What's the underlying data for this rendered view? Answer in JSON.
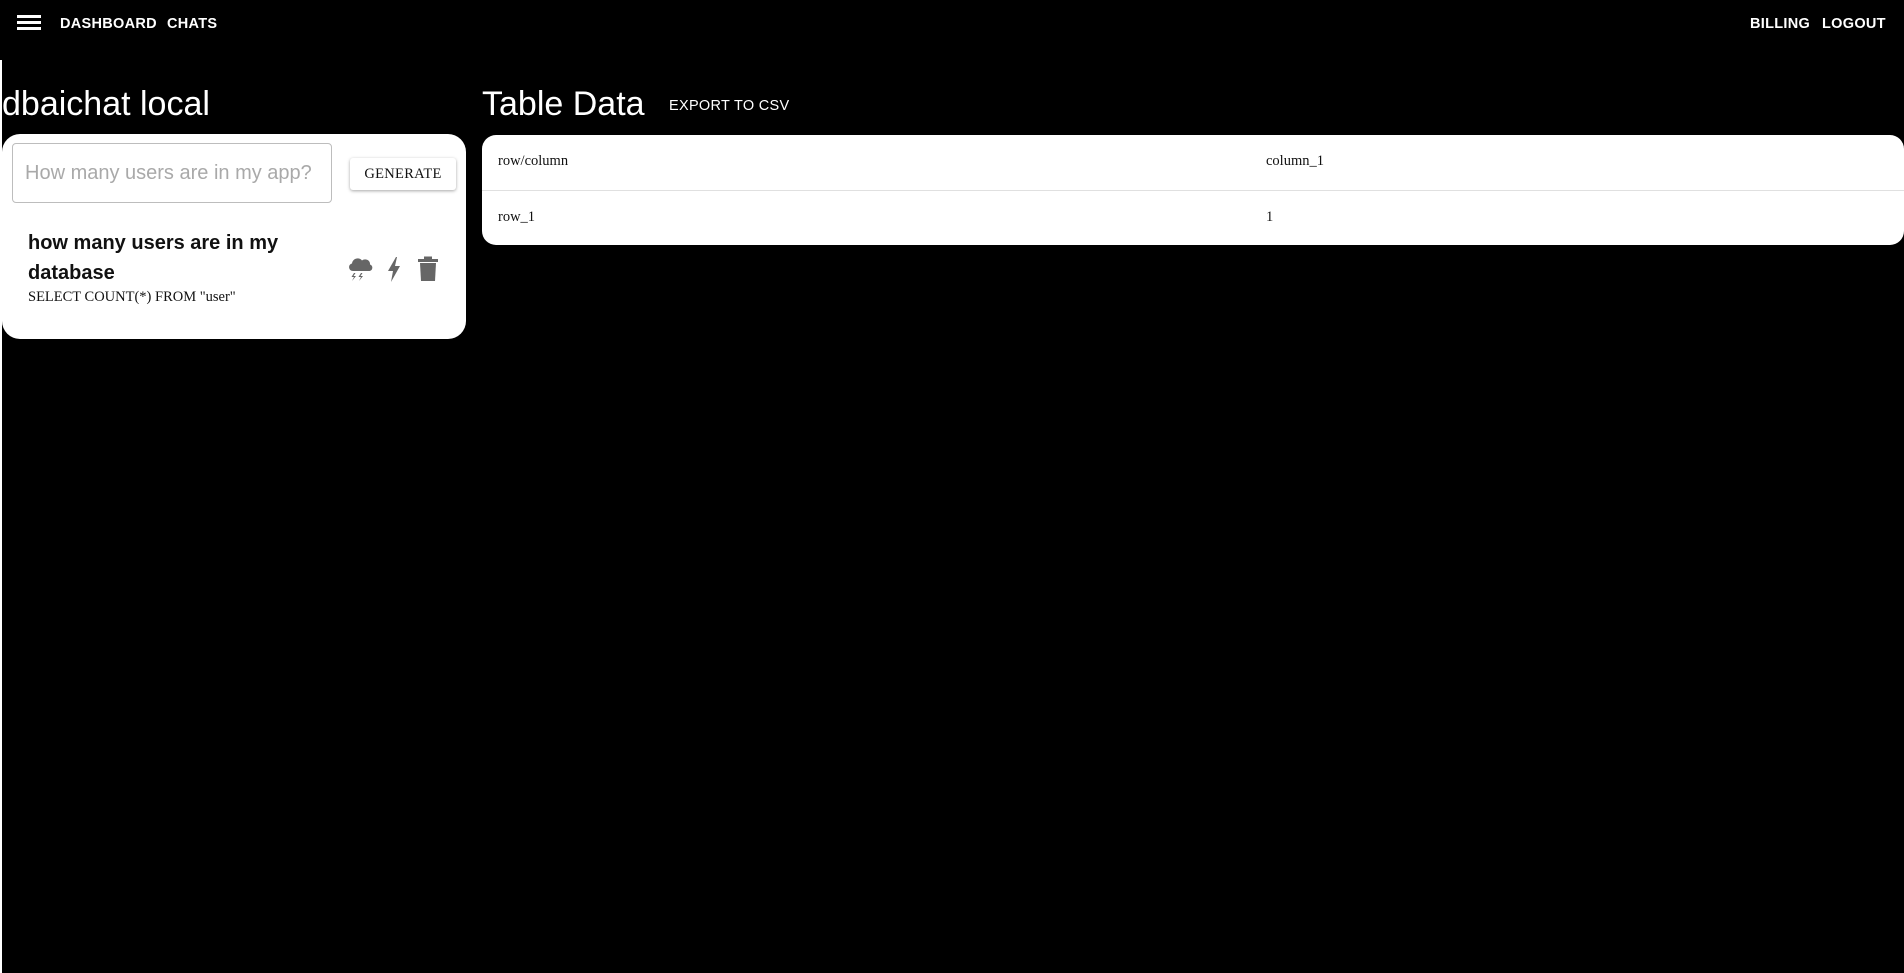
{
  "nav": {
    "menu_icon": "hamburger-menu-icon",
    "dashboard": "DASHBOARD",
    "chats": "CHATS",
    "billing": "BILLING",
    "logout": "LOGOUT"
  },
  "chat_panel": {
    "title": "dbaichat local",
    "input_value": "",
    "input_placeholder": "How many users are in my app?",
    "generate_label": "GENERATE",
    "items": [
      {
        "title": "how many users are in my database",
        "sql": "SELECT COUNT(*) FROM \"user\"",
        "icons": [
          "cloud-lightning-icon",
          "bolt-icon",
          "trash-icon"
        ]
      }
    ]
  },
  "table_panel": {
    "title": "Table Data",
    "export_label": "EXPORT TO CSV",
    "columns": [
      "row/column",
      "column_1"
    ],
    "rows": [
      [
        "row_1",
        "1"
      ]
    ]
  },
  "colors": {
    "background": "#000000",
    "card": "#ffffff",
    "icon": "#666666"
  }
}
